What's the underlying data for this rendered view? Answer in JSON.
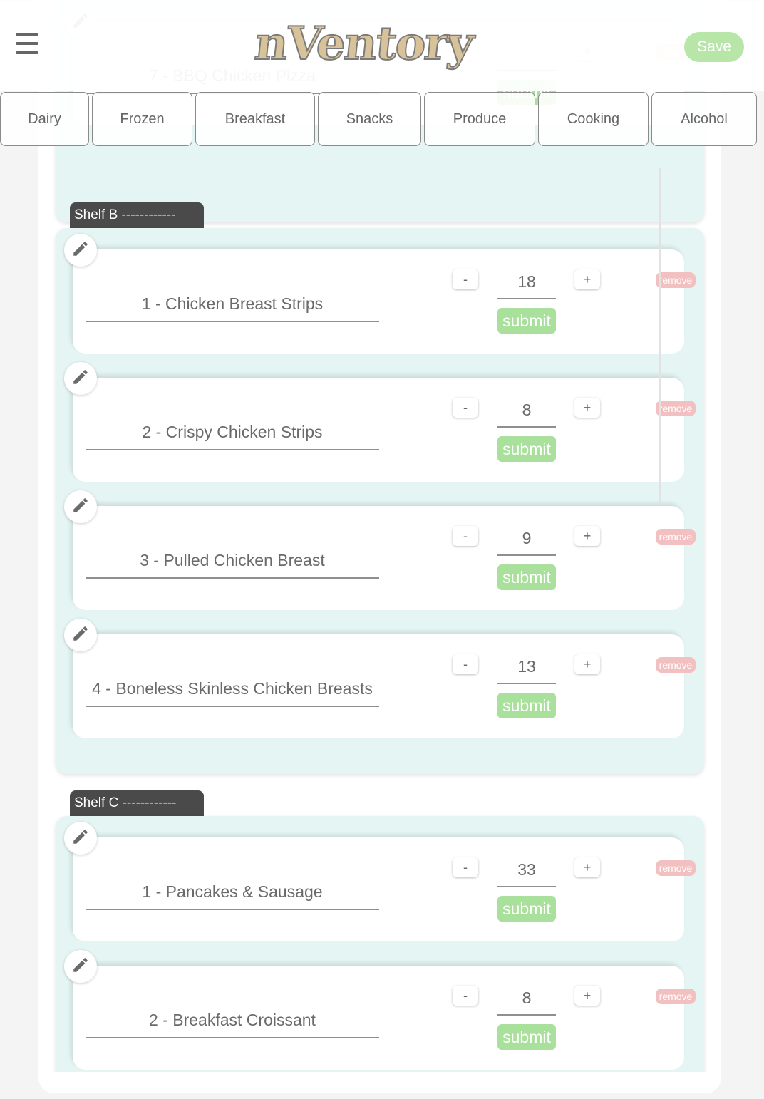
{
  "header": {
    "logo_text": "nVentory",
    "save_label": "Save"
  },
  "tabs": [
    "Dairy",
    "Frozen",
    "Breakfast",
    "Snacks",
    "Produce",
    "Cooking",
    "Alcohol"
  ],
  "shelves": [
    {
      "label": "",
      "items": [
        {
          "name": "7 - BBQ Chicken Pizza",
          "qty": ""
        }
      ]
    },
    {
      "label": "Shelf B ------------",
      "items": [
        {
          "name": "1 - Chicken Breast Strips",
          "qty": "18"
        },
        {
          "name": "2 - Crispy Chicken Strips",
          "qty": "8"
        },
        {
          "name": "3 - Pulled Chicken Breast",
          "qty": "9"
        },
        {
          "name": "4 - Boneless Skinless Chicken Breasts",
          "qty": "13"
        }
      ]
    },
    {
      "label": "Shelf C ------------",
      "items": [
        {
          "name": "1 - Pancakes & Sausage",
          "qty": "33"
        },
        {
          "name": "2 - Breakfast Croissant",
          "qty": "8"
        }
      ]
    }
  ],
  "item_controls": {
    "minus": "-",
    "plus": "+",
    "submit": "submit",
    "remove": "remove"
  },
  "colors": {
    "panel": "#e4f5f3",
    "submit": "#a9e09b",
    "remove": "#f2c0c0",
    "save": "#b8e6a8",
    "logo_fill": "#d8c29a"
  },
  "icons": {
    "menu": "hamburger-menu-icon",
    "edit": "pencil-icon"
  }
}
